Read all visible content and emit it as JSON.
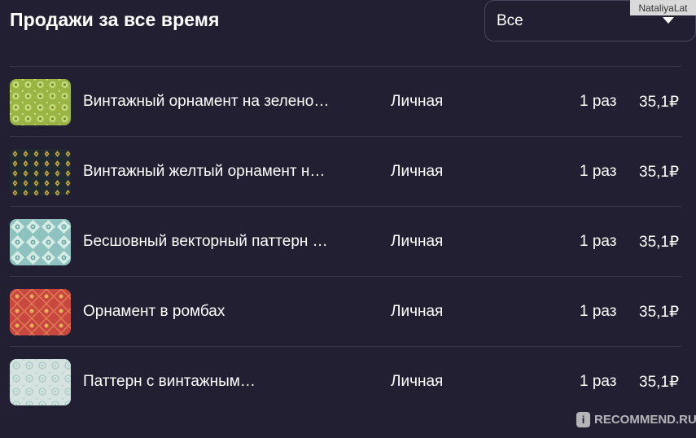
{
  "header": {
    "title": "Продажи за все время"
  },
  "filter": {
    "selected": "Все"
  },
  "watermarks": {
    "top": "NataliyaLat",
    "bottom": "RECOMMEND.RU",
    "bottom_logo": "i"
  },
  "sales": [
    {
      "name": "Винтажный орнамент на зелено…",
      "license": "Личная",
      "count": "1 раз",
      "price": "35,1₽",
      "thumb": "green-ornament"
    },
    {
      "name": "Винтажный желтый орнамент н…",
      "license": "Личная",
      "count": "1 раз",
      "price": "35,1₽",
      "thumb": "dark-yellow-ornament"
    },
    {
      "name": "Бесшовный векторный паттерн …",
      "license": "Личная",
      "count": "1 раз",
      "price": "35,1₽",
      "thumb": "teal-vector-pattern"
    },
    {
      "name": "Орнамент в ромбах",
      "license": "Личная",
      "count": "1 раз",
      "price": "35,1₽",
      "thumb": "red-rhombus-ornament"
    },
    {
      "name": "Паттерн с винтажным…",
      "license": "Личная",
      "count": "1 раз",
      "price": "35,1₽",
      "thumb": "light-vintage-pattern"
    }
  ],
  "colors": {
    "background": "#221f33",
    "divider": "#3a374c",
    "text": "#ffffff"
  }
}
